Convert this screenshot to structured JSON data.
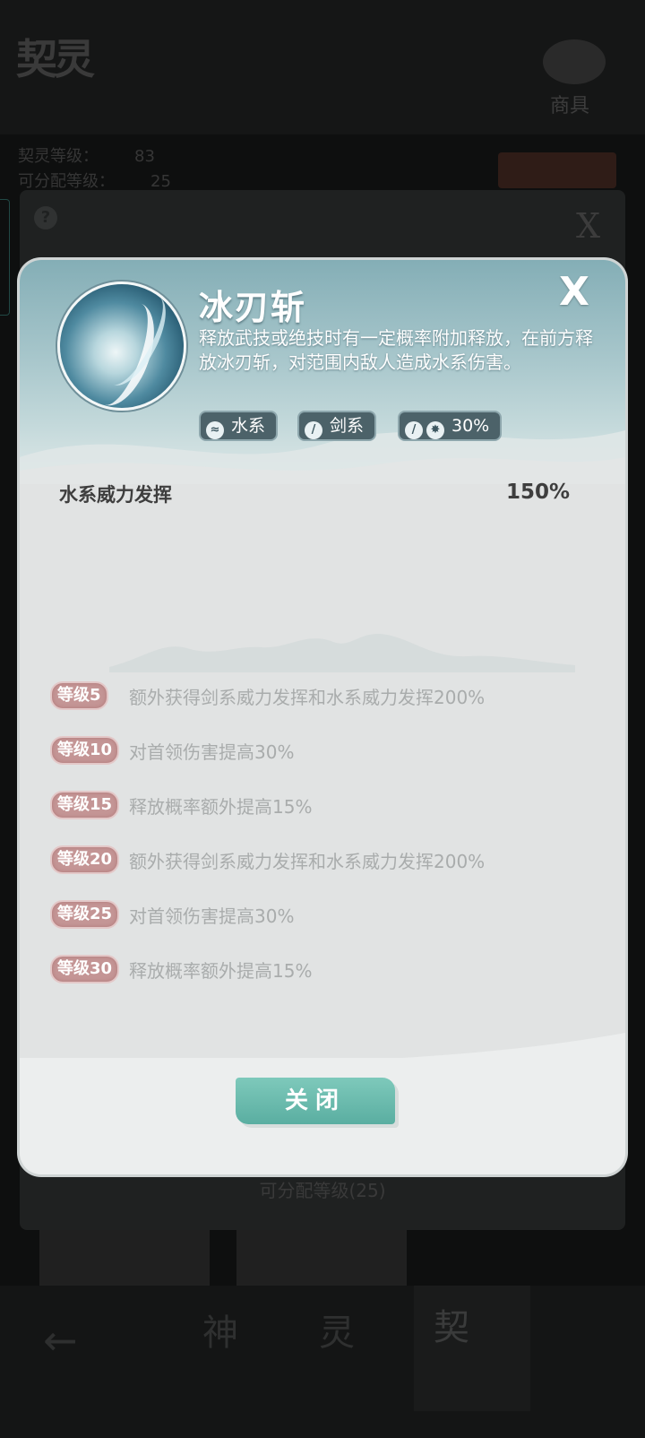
{
  "background": {
    "logo_text": "契灵",
    "shop_label": "商具",
    "stat_line_1_label": "契灵等级：",
    "stat_line_1_value": "83",
    "stat_line_2_label": "可分配等级：",
    "stat_line_2_value": "25",
    "help_label": "?",
    "close_label": "X",
    "assignable_levels": "可分配等级(25)",
    "nav": {
      "back_label": "←",
      "tab_1": "神",
      "tab_2": "灵",
      "tab_3": "契"
    }
  },
  "skill": {
    "name": "冰刃斩",
    "description": "释放武技或绝技时有一定概率附加释放，在前方释放冰刃斩，对范围内敌人造成水系伤害。",
    "close_label": "X",
    "tags": [
      {
        "label": "水系",
        "icon": "water-icon"
      },
      {
        "label": "剑系",
        "icon": "sword-icon"
      },
      {
        "label": "30%",
        "icon": "chance-icon"
      }
    ],
    "stat": {
      "label": "水系威力发挥",
      "value": "150%"
    },
    "levels": [
      {
        "badge": "等级5",
        "text": "额外获得剑系威力发挥和水系威力发挥200%"
      },
      {
        "badge": "等级10",
        "text": "对首领伤害提高30%"
      },
      {
        "badge": "等级15",
        "text": "释放概率额外提高15%"
      },
      {
        "badge": "等级20",
        "text": "额外获得剑系威力发挥和水系威力发挥200%"
      },
      {
        "badge": "等级25",
        "text": "对首领伤害提高30%"
      },
      {
        "badge": "等级30",
        "text": "释放概率额外提高15%"
      }
    ],
    "footer_button": "关闭"
  },
  "colors": {
    "header_accent": "#84aeb6",
    "level_badge": "#c49595",
    "button_teal": "#5aaea1"
  }
}
